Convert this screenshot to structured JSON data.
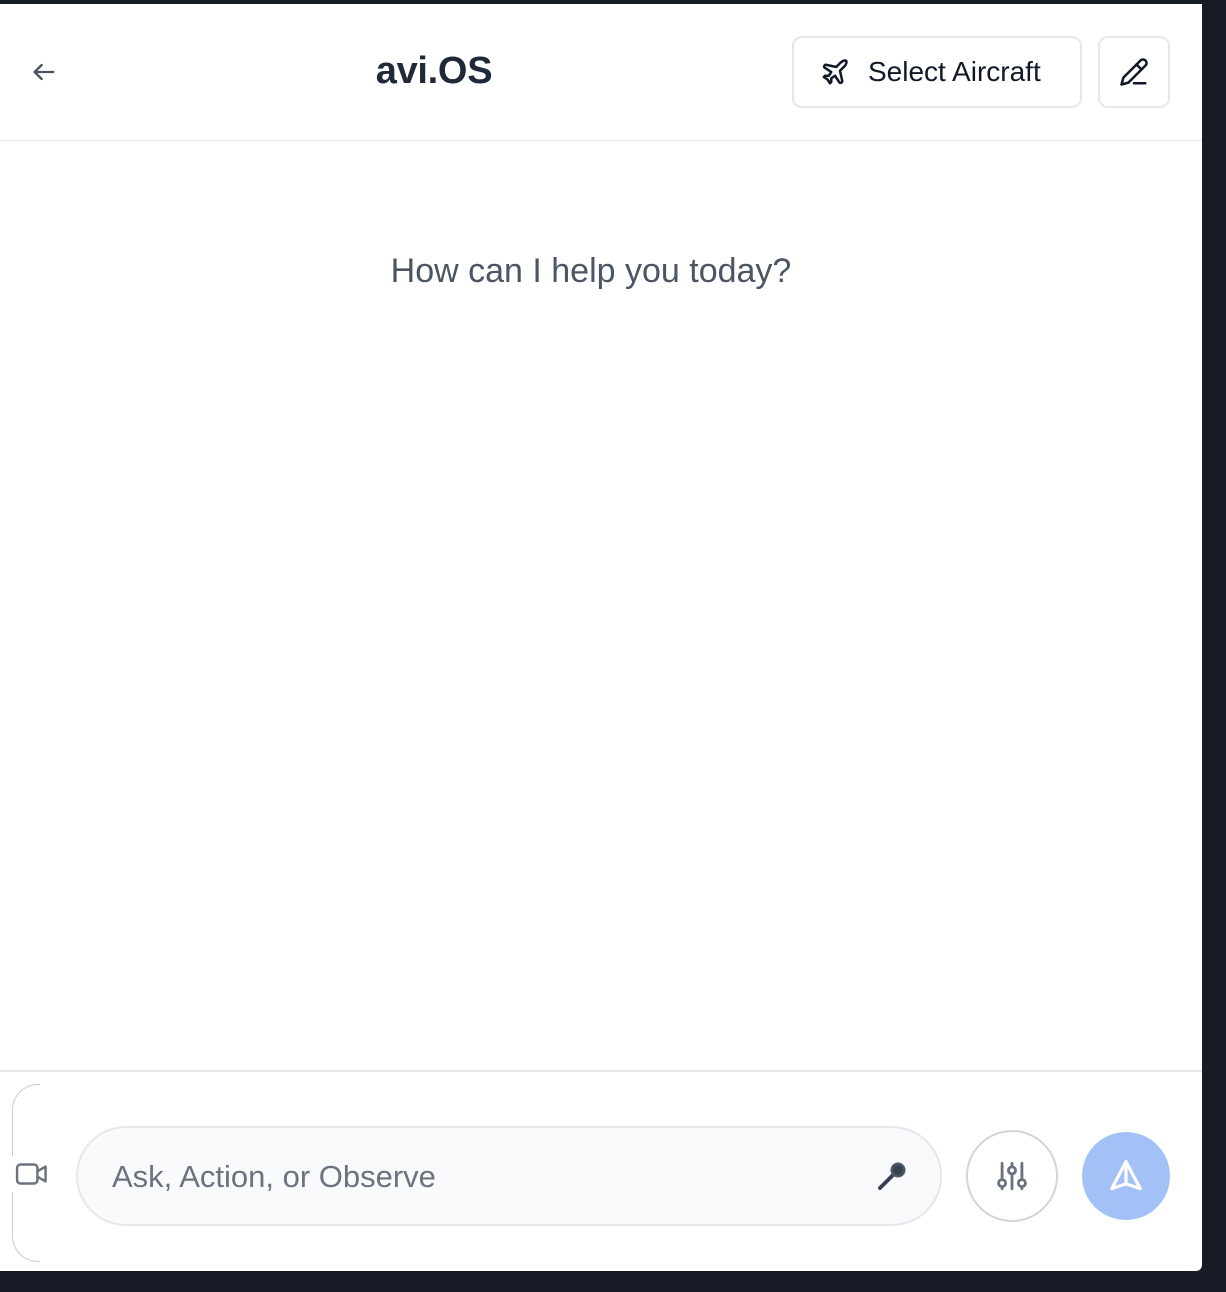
{
  "header": {
    "title": "avi.OS",
    "back_icon": "arrow-left-icon",
    "select_aircraft_label": "Select Aircraft",
    "select_aircraft_icon": "plane-icon",
    "edit_icon": "pencil-icon"
  },
  "main": {
    "greeting": "How can I help you today?"
  },
  "composer": {
    "placeholder": "Ask, Action, or Observe",
    "value": "",
    "video_icon": "video-camera-icon",
    "mic_icon": "microphone-icon",
    "settings_icon": "sliders-icon",
    "send_icon": "send-icon"
  },
  "colors": {
    "send_button": "#a4c1f7",
    "title_text": "#1f2937",
    "border": "#e5e7eb",
    "window_frame": "#161b26"
  }
}
